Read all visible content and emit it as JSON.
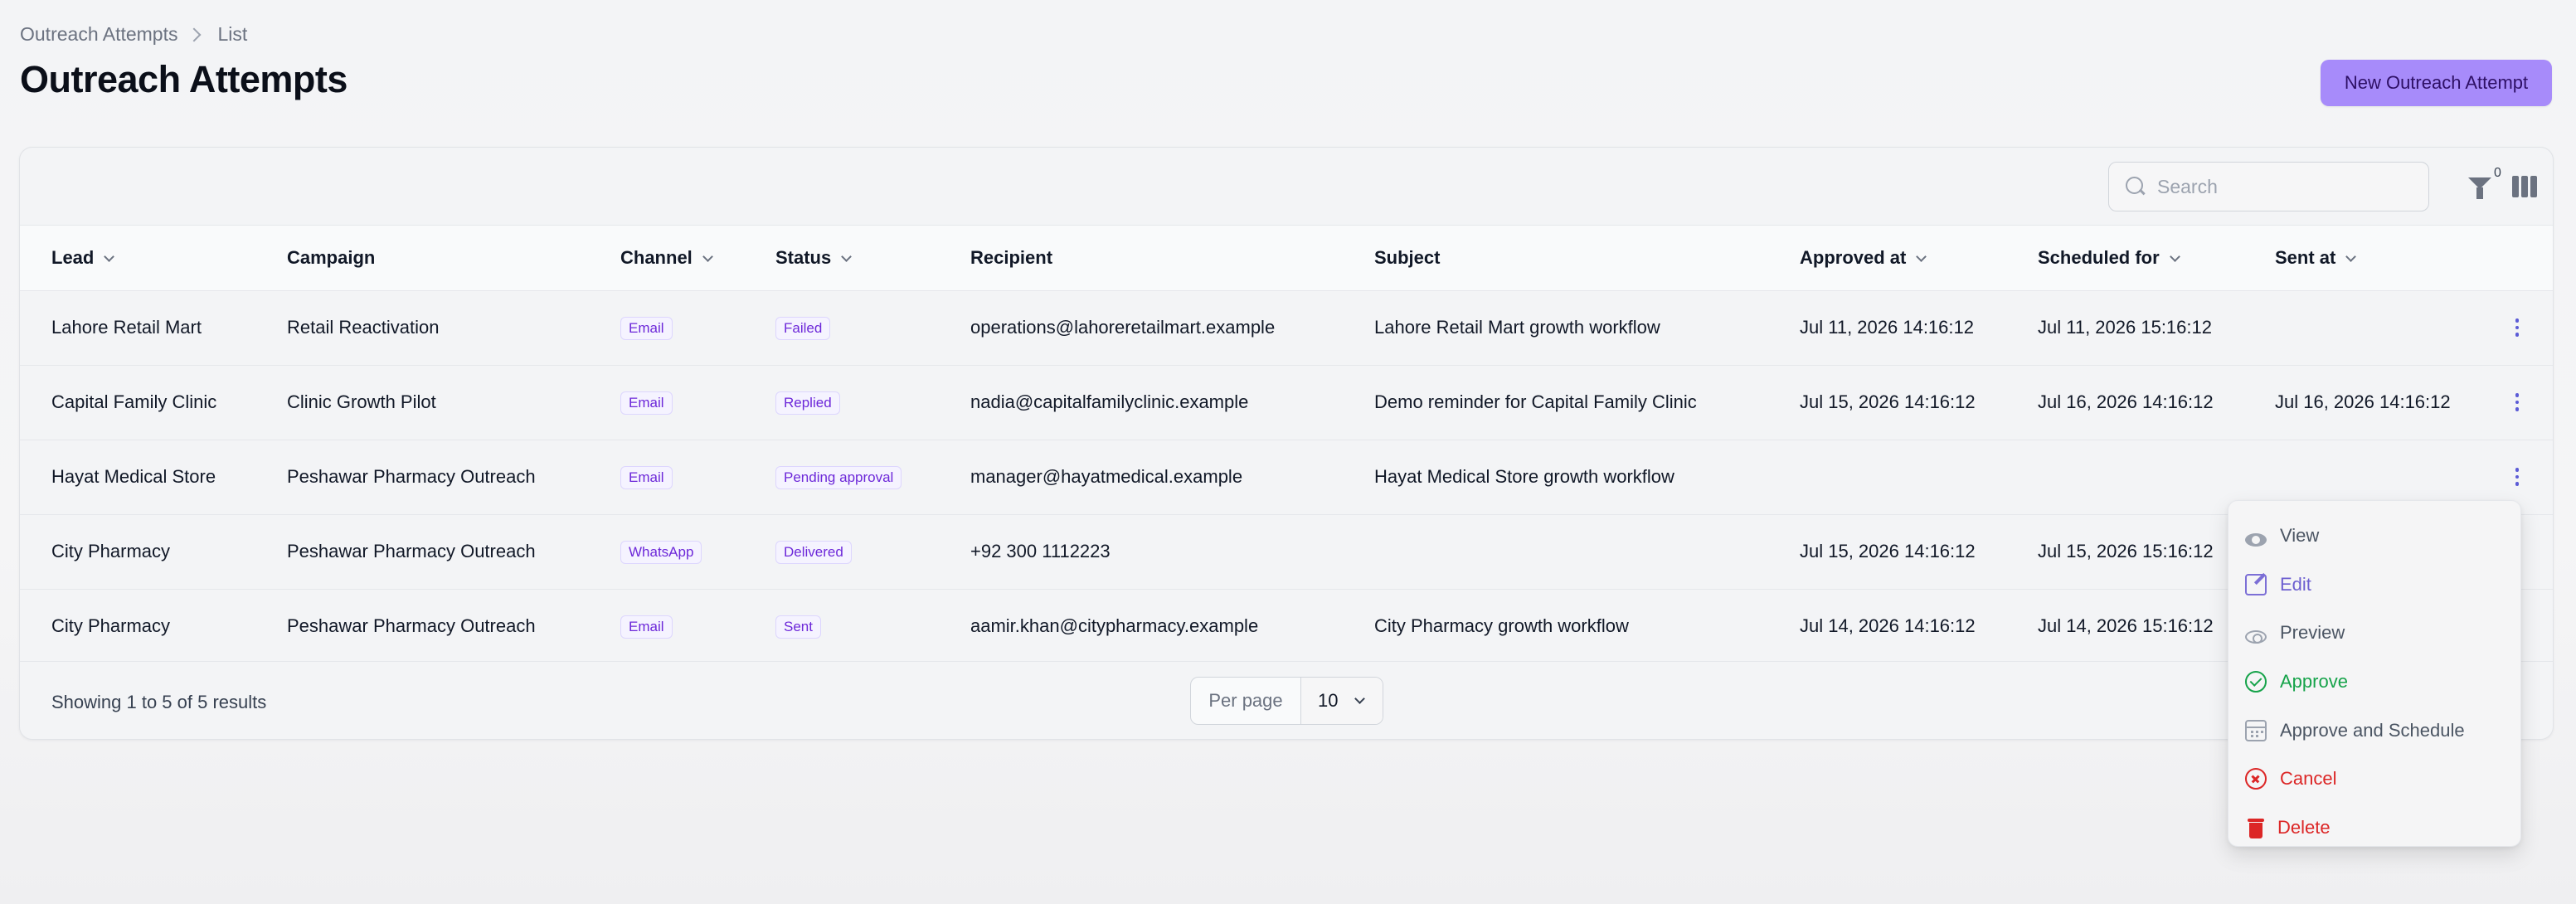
{
  "breadcrumb": {
    "parent": "Outreach Attempts",
    "current": "List"
  },
  "page": {
    "title": "Outreach Attempts",
    "new_button": "New Outreach Attempt"
  },
  "toolbar": {
    "search_placeholder": "Search",
    "filter_count": "0"
  },
  "table": {
    "headers": [
      "Lead",
      "Campaign",
      "Channel",
      "Status",
      "Recipient",
      "Subject",
      "Approved at",
      "Scheduled for",
      "Sent at"
    ],
    "rows": [
      {
        "lead": "Lahore Retail Mart",
        "campaign": "Retail Reactivation",
        "channel": "Email",
        "status": "Failed",
        "recipient": "operations@lahoreretailmart.example",
        "subject": "Lahore Retail Mart growth workflow",
        "approved_at": "Jul 11, 2026 14:16:12",
        "scheduled_for": "Jul 11, 2026 15:16:12",
        "sent_at": ""
      },
      {
        "lead": "Capital Family Clinic",
        "campaign": "Clinic Growth Pilot",
        "channel": "Email",
        "status": "Replied",
        "recipient": "nadia@capitalfamilyclinic.example",
        "subject": "Demo reminder for Capital Family Clinic",
        "approved_at": "Jul 15, 2026 14:16:12",
        "scheduled_for": "Jul 16, 2026 14:16:12",
        "sent_at": "Jul 16, 2026 14:16:12"
      },
      {
        "lead": "Hayat Medical Store",
        "campaign": "Peshawar Pharmacy Outreach",
        "channel": "Email",
        "status": "Pending approval",
        "recipient": "manager@hayatmedical.example",
        "subject": "Hayat Medical Store growth workflow",
        "approved_at": "",
        "scheduled_for": "",
        "sent_at": ""
      },
      {
        "lead": "City Pharmacy",
        "campaign": "Peshawar Pharmacy Outreach",
        "channel": "WhatsApp",
        "status": "Delivered",
        "recipient": "+92 300 1112223",
        "subject": "",
        "approved_at": "Jul 15, 2026 14:16:12",
        "scheduled_for": "Jul 15, 2026 15:16:12",
        "sent_at": ""
      },
      {
        "lead": "City Pharmacy",
        "campaign": "Peshawar Pharmacy Outreach",
        "channel": "Email",
        "status": "Sent",
        "recipient": "aamir.khan@citypharmacy.example",
        "subject": "City Pharmacy growth workflow",
        "approved_at": "Jul 14, 2026 14:16:12",
        "scheduled_for": "Jul 14, 2026 15:16:12",
        "sent_at": ""
      }
    ]
  },
  "footer": {
    "results": "Showing 1 to 5 of 5 results",
    "per_page_label": "Per page",
    "per_page_value": "10"
  },
  "action_menu": {
    "items": [
      {
        "label": "View",
        "icon": "eye-icon",
        "color": "#4b5563"
      },
      {
        "label": "Edit",
        "icon": "pencil-icon",
        "color": "#6d5fd0"
      },
      {
        "label": "Preview",
        "icon": "eye-outline-icon",
        "color": "#4b5563"
      },
      {
        "label": "Approve",
        "icon": "check-circle-icon",
        "color": "#16a34a"
      },
      {
        "label": "Approve and Schedule",
        "icon": "calendar-icon",
        "color": "#4b5563"
      },
      {
        "label": "Cancel",
        "icon": "x-circle-icon",
        "color": "#dc2626"
      },
      {
        "label": "Delete",
        "icon": "trash-icon",
        "color": "#dc2626"
      }
    ]
  },
  "colors": {
    "accent": "#a78bfa",
    "badge_text": "#6d28d9",
    "success": "#16a34a",
    "danger": "#dc2626"
  }
}
